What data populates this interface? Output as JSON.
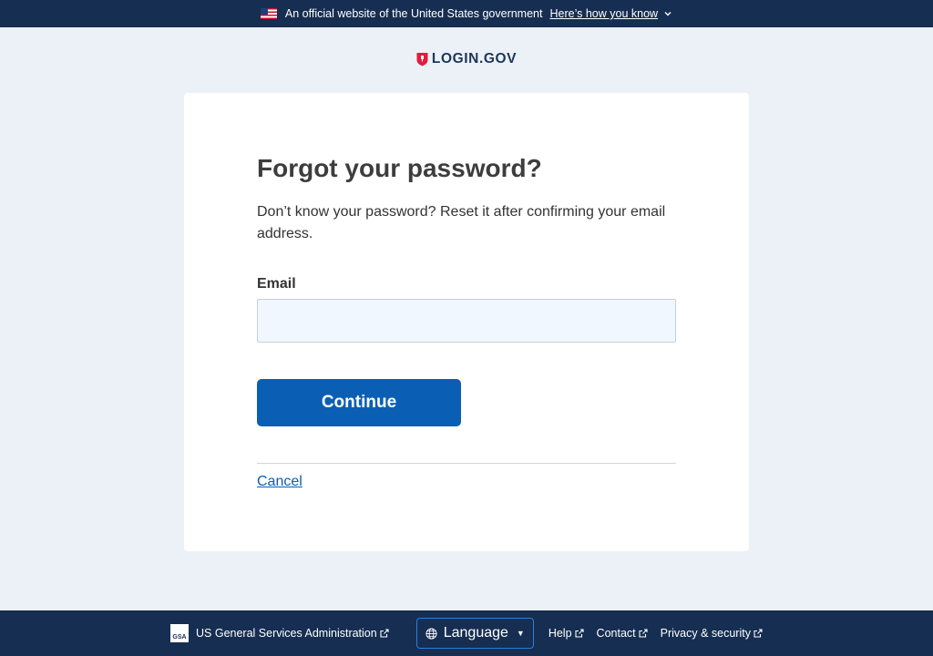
{
  "banner": {
    "text": "An official website of the United States government",
    "link": "Here’s how you know"
  },
  "logo": {
    "text": "LOGIN.GOV"
  },
  "main": {
    "title": "Forgot your password?",
    "intro": "Don’t know your password? Reset it after confirming your email address.",
    "email_label": "Email",
    "email_value": "",
    "continue_label": "Continue",
    "cancel_label": "Cancel"
  },
  "footer": {
    "gsa_logo_text": "GSA",
    "gsa_label": "US General Services Administration",
    "language_label": "Language",
    "links": [
      "Help",
      "Contact",
      "Privacy & security"
    ]
  },
  "colors": {
    "banner_bg": "#162e51",
    "page_bg": "#ecf1f7",
    "primary": "#0a5fb4",
    "logo_red": "#e21c3d",
    "input_bg": "#f1f7fe"
  },
  "icons": [
    "us-flag-icon",
    "chevron-down-icon",
    "login-shield-icon",
    "gsa-logo-icon",
    "external-link-icon",
    "globe-icon",
    "caret-down-icon"
  ]
}
